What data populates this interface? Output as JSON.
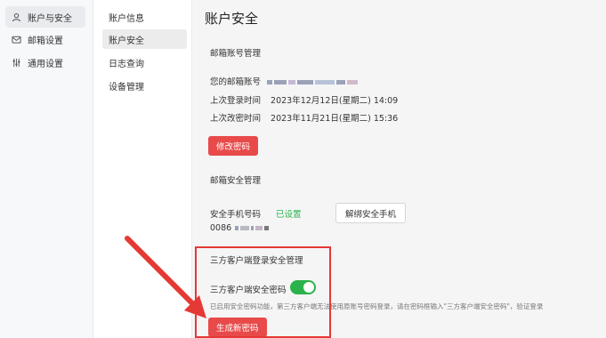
{
  "left_nav": {
    "items": [
      {
        "label": "账户与安全",
        "icon": "user-icon",
        "active": true
      },
      {
        "label": "邮箱设置",
        "icon": "mail-settings-icon",
        "active": false
      },
      {
        "label": "通用设置",
        "icon": "sliders-icon",
        "active": false
      }
    ]
  },
  "sub_nav": {
    "items": [
      {
        "label": "账户信息",
        "active": false
      },
      {
        "label": "账户安全",
        "active": true
      },
      {
        "label": "日志查询",
        "active": false
      },
      {
        "label": "设备管理",
        "active": false
      }
    ]
  },
  "main": {
    "title": "账户安全",
    "mailbox_section": {
      "title": "邮箱账号管理",
      "email_label": "您的邮箱账号",
      "last_login_label": "上次登录时间",
      "last_login_value": "2023年12月12日(星期二) 14:09",
      "last_pw_change_label": "上次改密时间",
      "last_pw_change_value": "2023年11月21日(星期二) 15:36",
      "change_password_button": "修改密码"
    },
    "security_section": {
      "title": "邮箱安全管理",
      "phone_label": "安全手机号码",
      "phone_status": "已设置",
      "unbind_button": "解绑安全手机",
      "phone_prefix": "0086"
    },
    "third_party_section": {
      "title": "三方客户端登录安全管理",
      "toggle_label": "三方客户端安全密码",
      "toggle_on": true,
      "hint": "已启用安全密码功能，第三方客户端无法使用原账号密码登录，请在密码框输入\"三方客户端安全密码\"，验证登录",
      "generate_button": "生成新密码"
    }
  },
  "colors": {
    "accent_red": "#e84a4a",
    "toggle_green": "#2bb24c",
    "annotation_red": "#e53935"
  }
}
